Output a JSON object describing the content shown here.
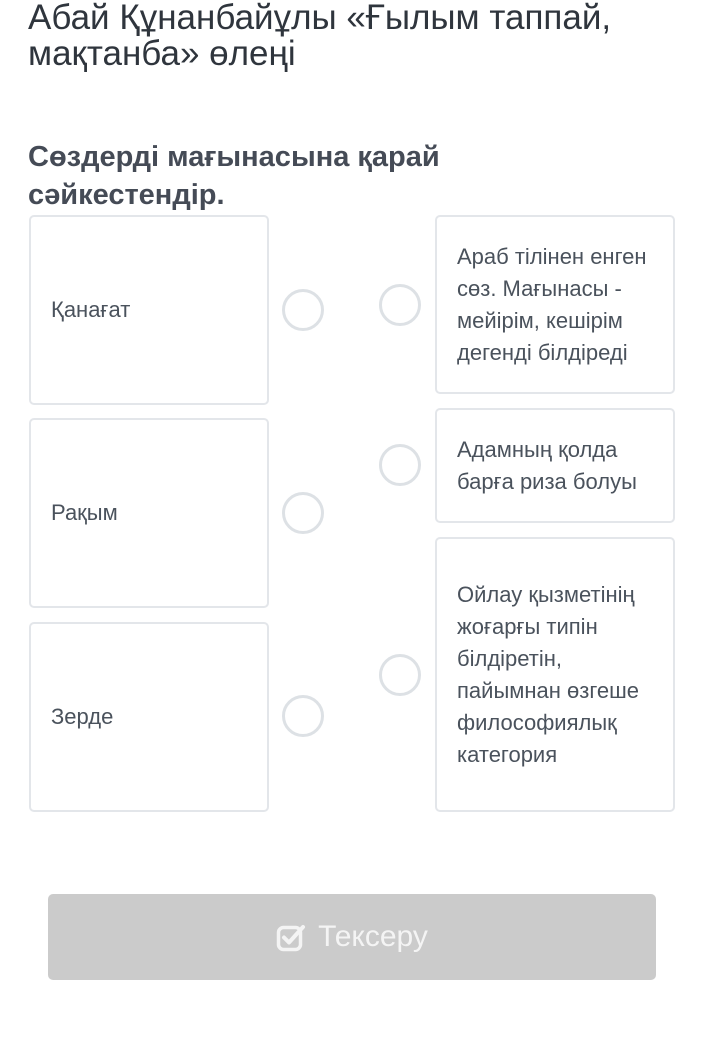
{
  "title": "Абай Құнанбайұлы «Ғылым таппай, мақтанба» өлеңі",
  "instruction": "Сөздерді мағынасына қарай сәйкестендір.",
  "left_items": [
    {
      "label": "Қанағат"
    },
    {
      "label": "Рақым"
    },
    {
      "label": "Зерде"
    }
  ],
  "right_items": [
    {
      "label": "Араб тілінен енген сөз. Мағынасы - мейірім, кешірім дегенді білдіреді"
    },
    {
      "label": "Адамның қолда барға риза болуы"
    },
    {
      "label": "Ойлау қызметінің жоғарғы типін білдіретін, пайымнан өзгеше философиялық категория"
    }
  ],
  "check_button": {
    "label": "Тексеру",
    "icon": "checkbox-check-icon",
    "background": "#cbcbcb"
  },
  "colors": {
    "card_border": "#e3e6ea",
    "radio_border": "#dde1e5",
    "text": "#4a525c"
  }
}
